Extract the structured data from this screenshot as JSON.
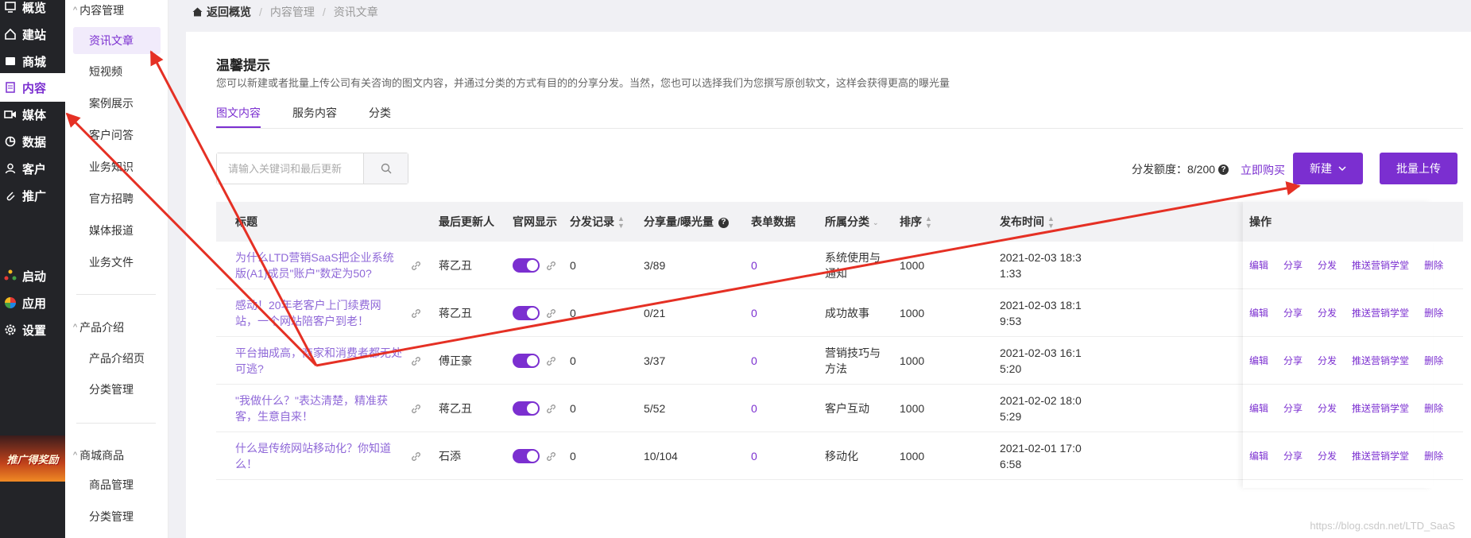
{
  "nav": {
    "items": [
      {
        "label": "概览",
        "icon": "overview-icon"
      },
      {
        "label": "建站",
        "icon": "home-icon"
      },
      {
        "label": "商城",
        "icon": "store-icon"
      },
      {
        "label": "内容",
        "icon": "document-icon",
        "active": true
      },
      {
        "label": "媒体",
        "icon": "video-icon"
      },
      {
        "label": "数据",
        "icon": "pie-chart-icon"
      },
      {
        "label": "客户",
        "icon": "user-icon"
      },
      {
        "label": "推广",
        "icon": "paperclip-icon"
      },
      {
        "label": "启动",
        "icon": "launch-icon"
      },
      {
        "label": "应用",
        "icon": "apps-icon"
      },
      {
        "label": "设置",
        "icon": "gear-icon"
      }
    ],
    "promo_text": "推广得奖励"
  },
  "submenu": {
    "group1": "内容管理",
    "group1_items": [
      "资讯文章",
      "短视频",
      "案例展示",
      "客户问答",
      "业务知识",
      "官方招聘",
      "媒体报道",
      "业务文件"
    ],
    "group2": "产品介绍",
    "group2_items": [
      "产品介绍页",
      "分类管理"
    ],
    "group3": "商城商品",
    "group3_items": [
      "商品管理",
      "分类管理"
    ]
  },
  "breadcrumb": {
    "home": "返回概览",
    "level1": "内容管理",
    "level2": "资讯文章"
  },
  "tip": {
    "title": "温馨提示",
    "desc": "您可以新建或者批量上传公司有关咨询的图文内容，并通过分类的方式有目的的分享分发。当然，您也可以选择我们为您撰写原创软文，这样会获得更高的曝光量"
  },
  "tabs": [
    "图文内容",
    "服务内容",
    "分类"
  ],
  "search": {
    "placeholder": "请输入关键词和最后更新"
  },
  "toolbar": {
    "quota_label": "分发额度：8/200",
    "buy_link": "立即购买",
    "new_button": "新建",
    "upload_button": "批量上传"
  },
  "table": {
    "headers": {
      "title": "标题",
      "updater": "最后更新人",
      "site_display": "官网显示",
      "dist_record": "分发记录",
      "share_views": "分享量/曝光量",
      "form_data": "表单数据",
      "category": "所属分类",
      "order": "排序",
      "publish_time": "发布时间",
      "ops": "操作"
    },
    "rows": [
      {
        "title": "为什么LTD营销SaaS把企业系统版(A1)成员\"账户\"数定为50?",
        "updater": "蒋乙丑",
        "dist": "0",
        "share": "3/89",
        "form": "0",
        "category": "系统使用与通知",
        "order": "1000",
        "time": "2021-02-03 18:31:33"
      },
      {
        "title": "感动！20年老客户上门续费网站，一个网站陪客户到老！",
        "updater": "蒋乙丑",
        "dist": "0",
        "share": "0/21",
        "form": "0",
        "category": "成功故事",
        "order": "1000",
        "time": "2021-02-03 18:19:53"
      },
      {
        "title": "平台抽成高，商家和消费者都无处可逃?",
        "updater": "傅正豪",
        "dist": "0",
        "share": "3/37",
        "form": "0",
        "category": "营销技巧与方法",
        "order": "1000",
        "time": "2021-02-03 16:15:20"
      },
      {
        "title": "\"我做什么？\"表达清楚，精准获客，生意自来！",
        "updater": "蒋乙丑",
        "dist": "0",
        "share": "5/52",
        "form": "0",
        "category": "客户互动",
        "order": "1000",
        "time": "2021-02-02 18:05:29"
      },
      {
        "title": "什么是传统网站移动化？你知道么！",
        "updater": "石添",
        "dist": "0",
        "share": "10/104",
        "form": "0",
        "category": "移动化",
        "order": "1000",
        "time": "2021-02-01 17:06:58"
      }
    ],
    "ops": [
      "编辑",
      "分享",
      "分发",
      "推送营销学堂",
      "删除"
    ]
  },
  "watermark": "https://blog.csdn.net/LTD_SaaS",
  "colors": {
    "accent": "#7b2fd0",
    "nav_bg": "#232428",
    "arrow": "#e53024"
  }
}
